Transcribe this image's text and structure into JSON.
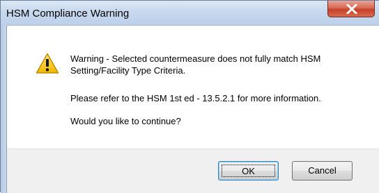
{
  "window": {
    "title": "HSM Compliance Warning",
    "close_label": "Close"
  },
  "icon": {
    "name": "warning-icon",
    "color": "#f5c400"
  },
  "message": {
    "line1": "Warning - Selected countermeasure does not fully match HSM Setting/Facility Type Criteria.",
    "line2": "Please refer to the HSM 1st ed - 13.5.2.1 for more information.",
    "line3": "Would you like to continue?"
  },
  "buttons": {
    "ok_label": "OK",
    "cancel_label": "Cancel"
  },
  "colors": {
    "title_bar": "#c8d9ee",
    "close_button": "#c5412a",
    "default_button_border": "#3c7fb1"
  }
}
